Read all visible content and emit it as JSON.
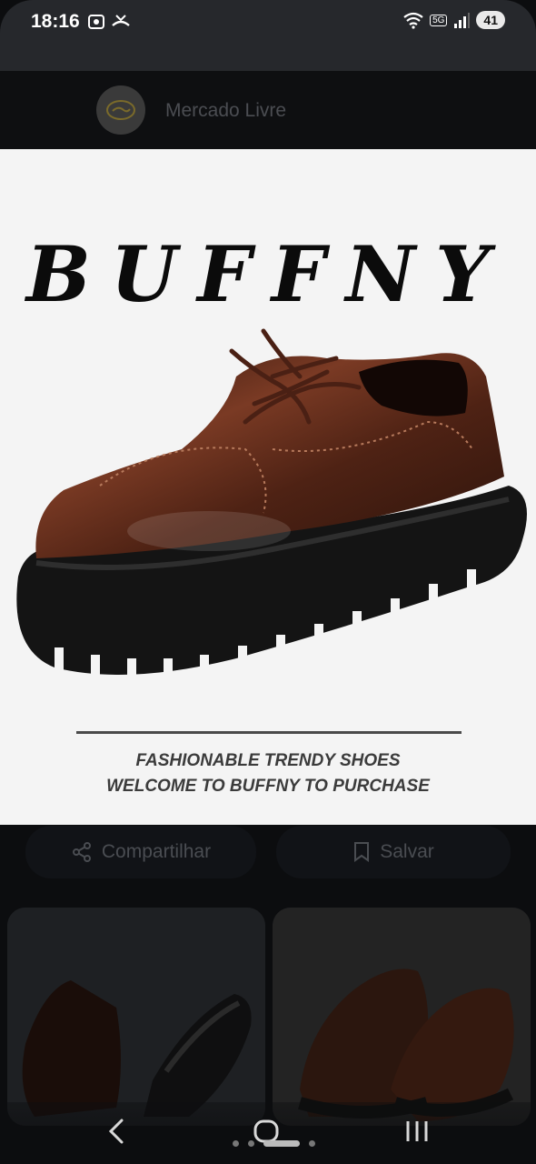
{
  "status_bar": {
    "time": "18:16",
    "battery": "41",
    "network": "5G"
  },
  "header": {
    "app_name": "Mercado Livre"
  },
  "hero": {
    "brand": "BUFFNY",
    "tagline_1": "FASHIONABLE TRENDY SHOES",
    "tagline_2": "WELCOME TO BUFFNY TO PURCHASE"
  },
  "actions": {
    "share_label": "Compartilhar",
    "save_label": "Salvar"
  },
  "colors": {
    "shoe": "#5a2b1c",
    "sole": "#141414",
    "background": "#0c0d0f"
  },
  "icons": [
    "back-icon",
    "home-icon",
    "recents-icon",
    "share-icon",
    "bookmark-icon",
    "wifi-icon",
    "signal-icon"
  ]
}
